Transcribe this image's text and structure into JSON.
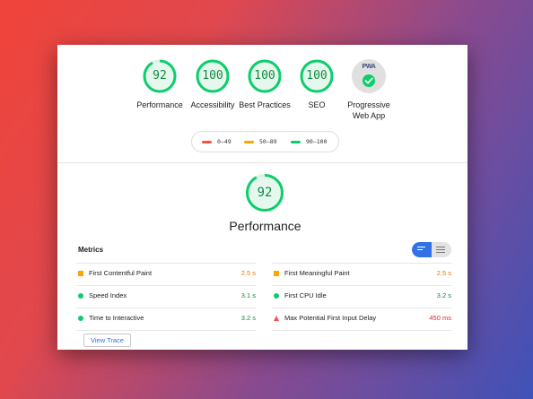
{
  "categories": [
    {
      "score": "92",
      "label": "Performance",
      "fraction": 0.92
    },
    {
      "score": "100",
      "label": "Accessibility",
      "fraction": 1.0
    },
    {
      "score": "100",
      "label": "Best Practices",
      "fraction": 1.0
    },
    {
      "score": "100",
      "label": "SEO",
      "fraction": 1.0
    }
  ],
  "pwa": {
    "badge": "PWA",
    "label": "Progressive Web App",
    "icon": "check-icon"
  },
  "legend": [
    {
      "range": "0–49",
      "color": "#ff4e42"
    },
    {
      "range": "50–89",
      "color": "#ffa400"
    },
    {
      "range": "90–100",
      "color": "#0cce6b"
    }
  ],
  "performance": {
    "score": "92",
    "title": "Performance",
    "fraction": 0.92
  },
  "metrics": {
    "title": "Metrics",
    "left": [
      {
        "name": "First Contentful Paint",
        "value": "2.5 s",
        "status": "average"
      },
      {
        "name": "Speed Index",
        "value": "3.1 s",
        "status": "pass"
      },
      {
        "name": "Time to Interactive",
        "value": "3.2 s",
        "status": "pass"
      }
    ],
    "right": [
      {
        "name": "First Meaningful Paint",
        "value": "2.5 s",
        "status": "average"
      },
      {
        "name": "First CPU Idle",
        "value": "3.2 s",
        "status": "pass"
      },
      {
        "name": "Max Potential First Input Delay",
        "value": "450 ms",
        "status": "fail"
      }
    ]
  },
  "view_trace_label": "View Trace",
  "colors": {
    "pass": "#0cce6b",
    "average": "#ffa400",
    "fail": "#ff4e42",
    "accent": "#3371e6"
  }
}
